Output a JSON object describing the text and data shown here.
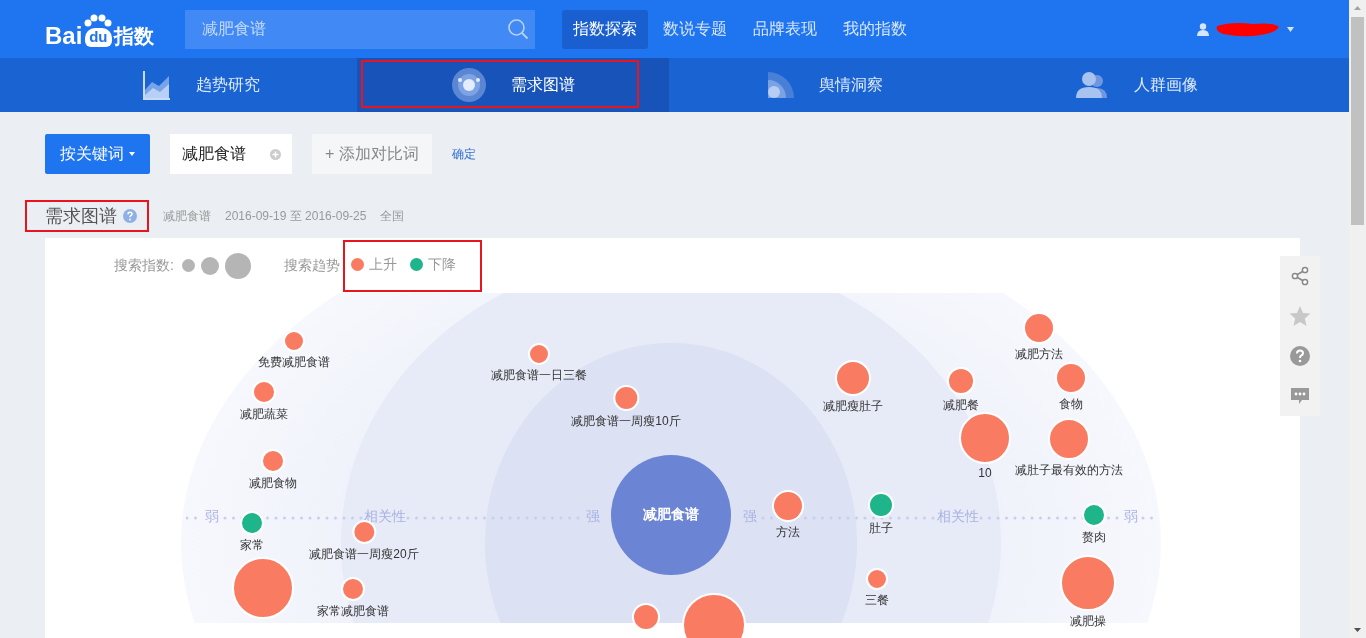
{
  "header": {
    "logo": {
      "left": "Bai",
      "mid": "du",
      "right": "指数"
    },
    "search": {
      "value": "减肥食谱"
    },
    "nav": [
      {
        "label": "指数探索",
        "selected": true
      },
      {
        "label": "数说专题",
        "selected": false
      },
      {
        "label": "品牌表现",
        "selected": false
      },
      {
        "label": "我的指数",
        "selected": false
      }
    ],
    "user": {
      "name_redacted": true
    }
  },
  "tabs": [
    {
      "label": "趋势研究",
      "kind": "trend",
      "selected": false,
      "highlighted": false
    },
    {
      "label": "需求图谱",
      "kind": "graph",
      "selected": true,
      "highlighted": true
    },
    {
      "label": "舆情洞察",
      "kind": "signal",
      "selected": false,
      "highlighted": false
    },
    {
      "label": "人群画像",
      "kind": "people",
      "selected": false,
      "highlighted": false
    }
  ],
  "controls": {
    "mode_button": "按关键词",
    "keyword": "减肥食谱",
    "add_button": "+ 添加对比词",
    "confirm_link": "确定"
  },
  "section": {
    "title": "需求图谱",
    "highlighted": true,
    "keyword": "减肥食谱",
    "date_range": "2016-09-19 至 2016-09-25",
    "region": "全国"
  },
  "legend": {
    "size_label": "搜索指数:",
    "trend_label": "搜索趋势",
    "highlighted": true,
    "trends": [
      {
        "label": "上升",
        "color": "#f97c62"
      },
      {
        "label": "下降",
        "color": "#1fb58a"
      }
    ]
  },
  "graph": {
    "axis_labels": [
      "弱",
      "相关性",
      "强",
      "强",
      "相关性",
      "弱"
    ],
    "nodes": [
      {
        "label": "减肥方法",
        "kind": "up"
      },
      {
        "label": "免费减肥食谱",
        "kind": "up"
      },
      {
        "label": "减肥食谱一日三餐",
        "kind": "up"
      },
      {
        "label": "减肥瘦肚子",
        "kind": "up"
      },
      {
        "label": "减肥餐",
        "kind": "up"
      },
      {
        "label": "食物",
        "kind": "up"
      },
      {
        "label": "减肥蔬菜",
        "kind": "up"
      },
      {
        "label": "减肥食谱一周瘦10斤",
        "kind": "up"
      },
      {
        "label": "10",
        "kind": "up"
      },
      {
        "label": "减肚子最有效的方法",
        "kind": "up"
      },
      {
        "label": "减肥食物",
        "kind": "up"
      },
      {
        "label": "肚子",
        "kind": "down"
      },
      {
        "label": "方法",
        "kind": "up"
      },
      {
        "label": "减肥食谱",
        "kind": "center"
      },
      {
        "label": "赘肉",
        "kind": "down"
      },
      {
        "label": "家常",
        "kind": "down"
      },
      {
        "label": "减肥食谱一周瘦20斤",
        "kind": "up"
      },
      {
        "label": "三餐",
        "kind": "up"
      },
      {
        "label": "减肥操",
        "kind": "up"
      },
      {
        "kind": "up"
      },
      {
        "label": "家常减肥食谱",
        "kind": "up"
      },
      {
        "kind": "up"
      },
      {
        "kind": "up"
      }
    ]
  }
}
